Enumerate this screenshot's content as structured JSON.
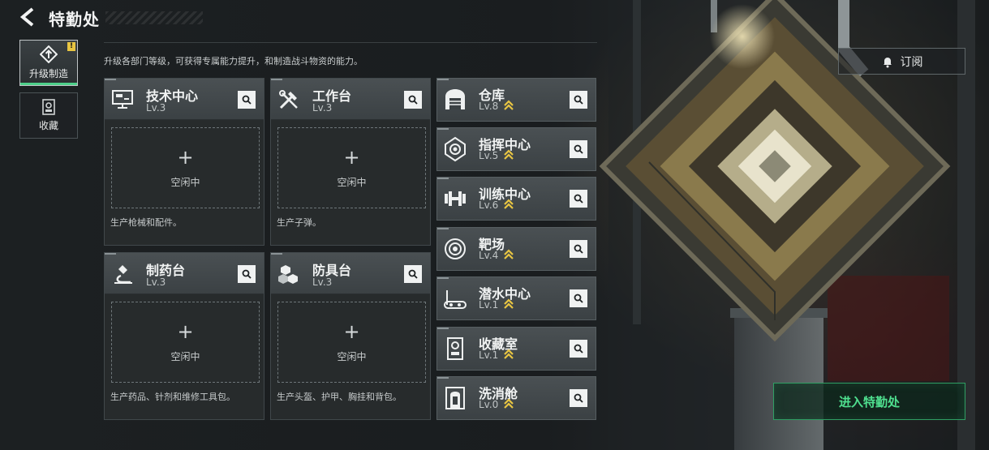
{
  "header": {
    "title": "特勤处"
  },
  "nav": [
    {
      "label": "升级制造",
      "icon": "upgrade-build-icon",
      "active": true,
      "badge": "!"
    },
    {
      "label": "收藏",
      "icon": "collection-icon",
      "active": false
    }
  ],
  "description": "升级各部门等级，可获得专属能力提升，和制造战斗物资的能力。",
  "stations": [
    {
      "name": "技术中心",
      "level": "Lv.3",
      "icon": "computer-icon",
      "slot_plus": "+",
      "slot_status": "空闲中",
      "desc": "生产枪械和配件。"
    },
    {
      "name": "工作台",
      "level": "Lv.3",
      "icon": "tools-icon",
      "slot_plus": "+",
      "slot_status": "空闲中",
      "desc": "生产子弹。"
    },
    {
      "name": "制药台",
      "level": "Lv.3",
      "icon": "microscope-icon",
      "slot_plus": "+",
      "slot_status": "空闲中",
      "desc": "生产药品、针剂和维修工具包。"
    },
    {
      "name": "防具台",
      "level": "Lv.3",
      "icon": "armor-blocks-icon",
      "slot_plus": "+",
      "slot_status": "空闲中",
      "desc": "生产头盔、护甲、胸挂和背包。"
    }
  ],
  "facilities": [
    {
      "name": "仓库",
      "level": "Lv.8",
      "icon": "warehouse-icon",
      "upgradable": true
    },
    {
      "name": "指挥中心",
      "level": "Lv.5",
      "icon": "command-center-icon",
      "upgradable": true
    },
    {
      "name": "训练中心",
      "level": "Lv.6",
      "icon": "dumbbell-icon",
      "upgradable": true
    },
    {
      "name": "靶场",
      "level": "Lv.4",
      "icon": "target-icon",
      "upgradable": true
    },
    {
      "name": "潜水中心",
      "level": "Lv.1",
      "icon": "diving-icon",
      "upgradable": true
    },
    {
      "name": "收藏室",
      "level": "Lv.1",
      "icon": "collection-room-icon",
      "upgradable": true
    },
    {
      "name": "洗消舱",
      "level": "Lv.0",
      "icon": "decontamination-icon",
      "upgradable": true
    }
  ],
  "subscribe": {
    "label": "订阅",
    "icon": "bell-icon"
  },
  "enter": {
    "label": "进入特勤处"
  },
  "colors": {
    "accent_green": "#4fe08f",
    "upgrade_gold": "#e8c542",
    "badge_yellow": "#e8c542"
  }
}
